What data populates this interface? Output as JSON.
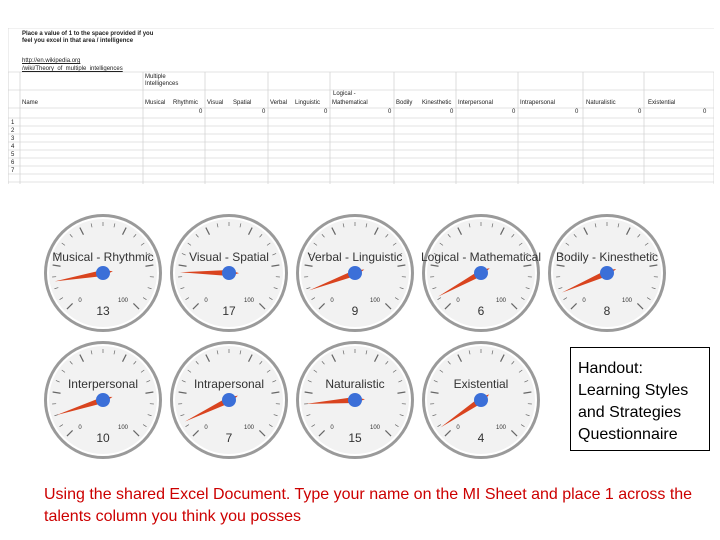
{
  "spreadsheet": {
    "instruction": "Place a value of 1 to the space provided if you feel you excel in that area / intelligence",
    "link_line1": "http://en.wikipedia.org",
    "link_line2": "/wiki/Theory_of_multiple_intelligences",
    "group_header": "Multiple Intelligences",
    "logical_header": "Logical -",
    "name_header": "Name",
    "columns": [
      "Musical",
      "Rhythmic",
      "Visual",
      "Spatial",
      "Verbal",
      "Linguistic",
      "Mathematical",
      "Bodily",
      "Kinesthetic",
      "Interpersonal",
      "Intrapersonal",
      "Naturalistic",
      "Existential"
    ],
    "totals": [
      "0",
      "0",
      "0",
      "0",
      "0",
      "0",
      "0",
      "0",
      "0"
    ],
    "row_numbers": [
      "1",
      "2",
      "3",
      "4",
      "5",
      "6",
      "7"
    ]
  },
  "gauges": [
    {
      "title": "Musical - Rhythmic",
      "value": 13,
      "min_label": "0",
      "max_label": "100"
    },
    {
      "title": "Visual - Spatial",
      "value": 17,
      "min_label": "0",
      "max_label": "100"
    },
    {
      "title": "Verbal - Linguistic",
      "value": 9,
      "min_label": "0",
      "max_label": "100"
    },
    {
      "title": "Logical - Mathematical",
      "value": 6,
      "min_label": "0",
      "max_label": "100"
    },
    {
      "title": "Bodily - Kinesthetic",
      "value": 8,
      "min_label": "0",
      "max_label": "100"
    },
    {
      "title": "Interpersonal",
      "value": 10,
      "min_label": "0",
      "max_label": "100"
    },
    {
      "title": "Intrapersonal",
      "value": 7,
      "min_label": "0",
      "max_label": "100"
    },
    {
      "title": "Naturalistic",
      "value": 15,
      "min_label": "0",
      "max_label": "100"
    },
    {
      "title": "Existential",
      "value": 4,
      "min_label": "0",
      "max_label": "100"
    }
  ],
  "handout": "Handout: Learning Styles and Strategies Questionnaire",
  "caption": "Using the shared Excel Document. Type your name on the MI Sheet and place 1 across the talents column you think you posses",
  "colors": {
    "caption": "#cc0000",
    "needle": "#d9441f",
    "hub": "#3b6fd8",
    "gauge_face": "#f2f2f2",
    "link": "#1155cc"
  }
}
